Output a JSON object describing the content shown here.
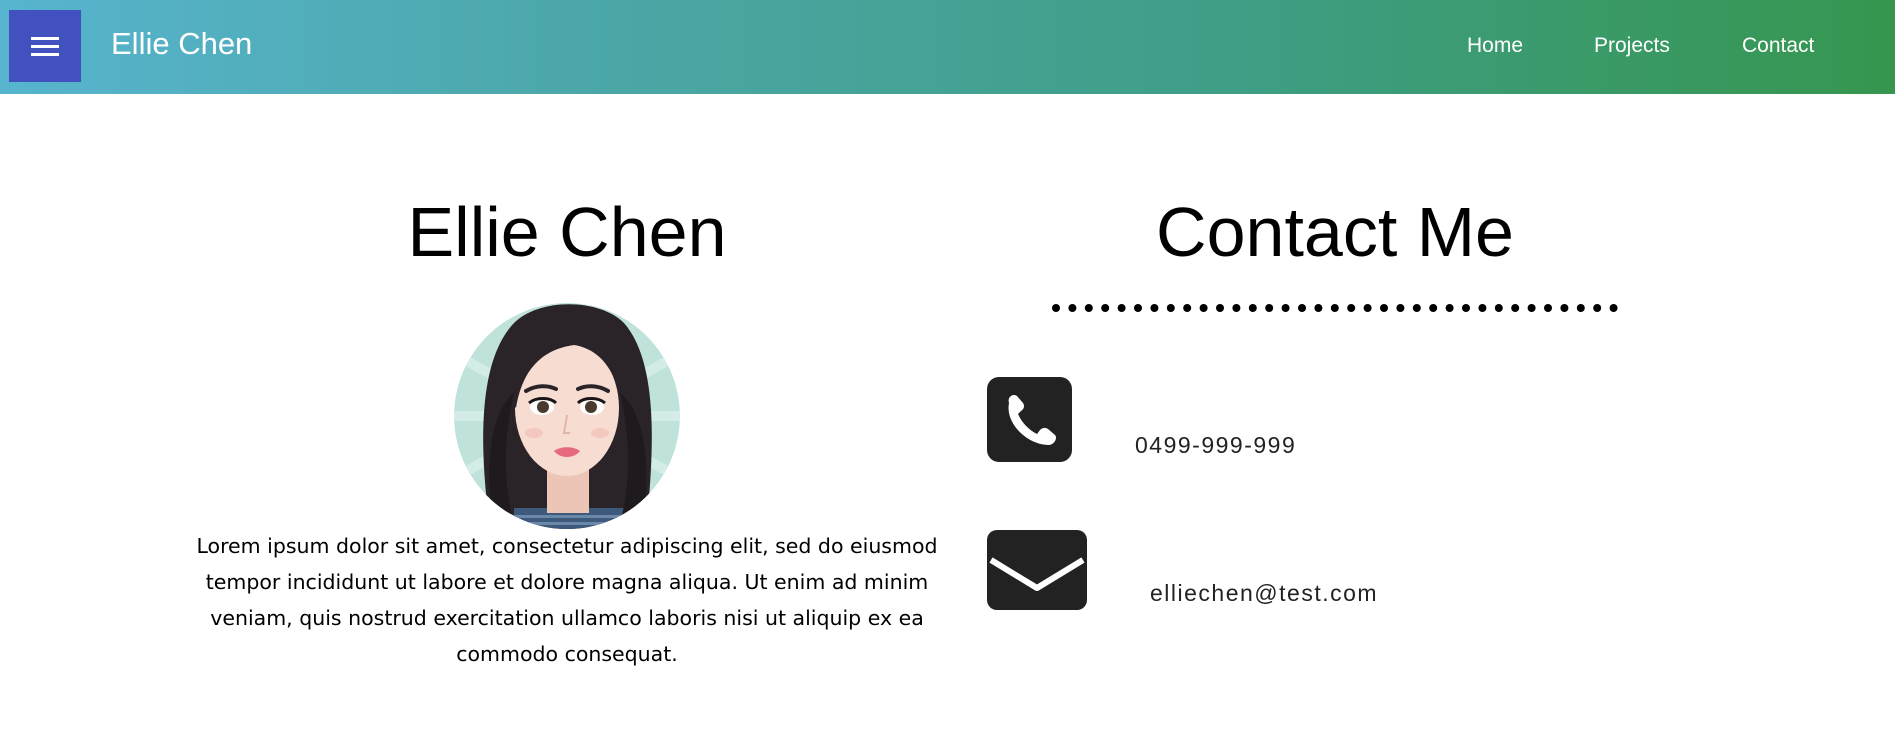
{
  "navbar": {
    "brand": "Ellie Chen",
    "links": [
      "Home",
      "Projects",
      "Contact"
    ],
    "gradient_start": "#57b4ce",
    "gradient_end": "#36964f",
    "menu_button_color": "#4151c0",
    "menu_icon": "hamburger-icon"
  },
  "profile": {
    "name": "Ellie Chen",
    "avatar": "avatar-illustration",
    "bio": "Lorem ipsum dolor sit amet, consectetur adipiscing elit, sed do eiusmod tempor incididunt ut labore et dolore magna aliqua. Ut enim ad minim veniam, quis nostrud exercitation ullamco laboris nisi ut aliquip ex ea commodo consequat."
  },
  "contact": {
    "heading": "Contact Me",
    "phone_icon": "phone-icon",
    "phone": "0499-999-999",
    "email_icon": "envelope-icon",
    "email": "elliechen@test.com"
  }
}
